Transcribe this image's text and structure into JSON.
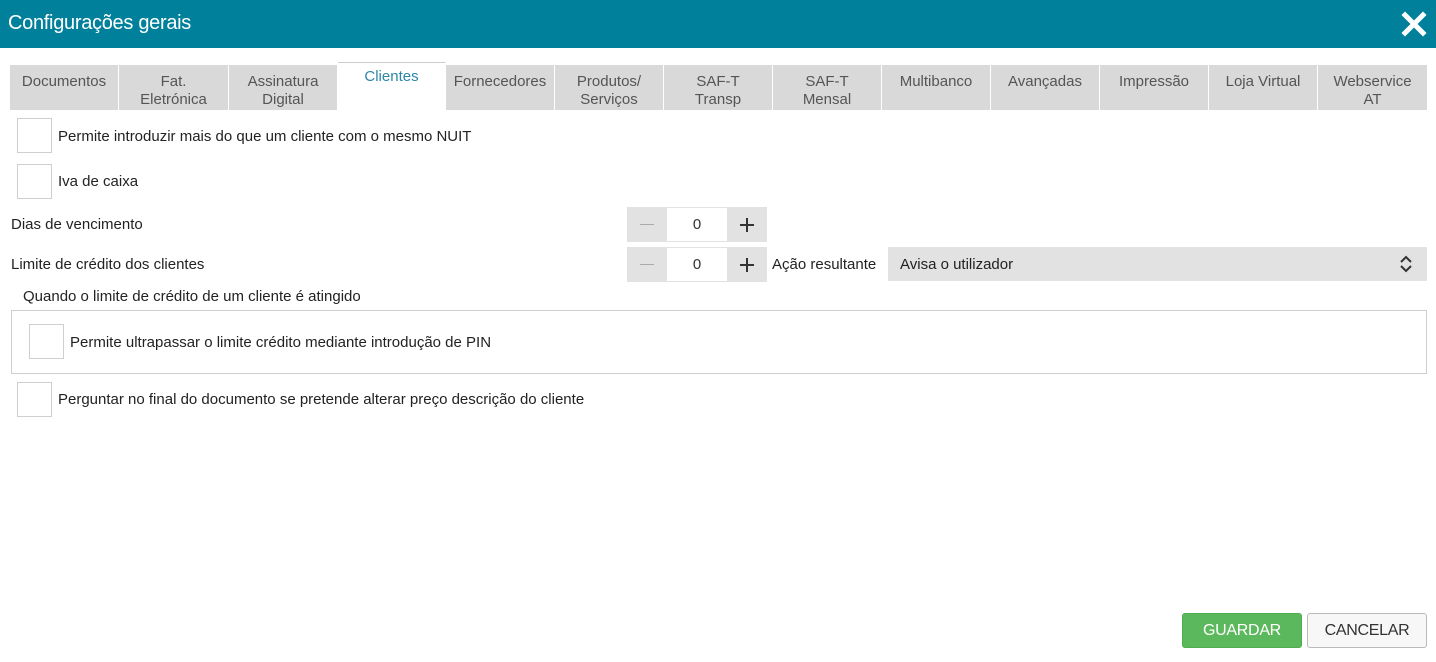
{
  "dialog": {
    "title": "Configurações gerais",
    "close_icon": "close-icon"
  },
  "tabs": [
    {
      "label": "Documentos",
      "active": false
    },
    {
      "label": "Fat.\nEletrónica",
      "active": false
    },
    {
      "label": "Assinatura\nDigital",
      "active": false
    },
    {
      "label": "Clientes",
      "active": true
    },
    {
      "label": "Fornecedores",
      "active": false
    },
    {
      "label": "Produtos/\nServiços",
      "active": false
    },
    {
      "label": "SAF-T\nTransp",
      "active": false
    },
    {
      "label": "SAF-T\nMensal",
      "active": false
    },
    {
      "label": "Multibanco",
      "active": false
    },
    {
      "label": "Avançadas",
      "active": false
    },
    {
      "label": "Impressão",
      "active": false
    },
    {
      "label": "Loja Virtual",
      "active": false
    },
    {
      "label": "Webservice\nAT",
      "active": false
    }
  ],
  "options": {
    "allow_same_nuit": {
      "label": "Permite introduzir mais do que um cliente com o mesmo NUIT",
      "checked": false
    },
    "cash_vat": {
      "label": "Iva de caixa",
      "checked": false
    },
    "due_days": {
      "label": "Dias de vencimento",
      "value": "0"
    },
    "credit_limit": {
      "label": "Limite de crédito dos clientes",
      "value": "0"
    },
    "resulting_action": {
      "label": "Ação resultante",
      "value": "Avisa o utilizador"
    },
    "limit_reached": {
      "label": "Quando o limite de crédito de um cliente é atingido"
    },
    "allow_pin_override": {
      "label": "Permite ultrapassar o limite crédito mediante introdução de PIN",
      "checked": false
    },
    "ask_price_change": {
      "label": "Perguntar no final do documento se pretende alterar preço descrição do cliente",
      "checked": false
    }
  },
  "buttons": {
    "save": "GUARDAR",
    "cancel": "CANCELAR"
  },
  "colors": {
    "titlebar": "#00809a",
    "active_tab_text": "#2c86a8",
    "save_button": "#5cb85c"
  }
}
